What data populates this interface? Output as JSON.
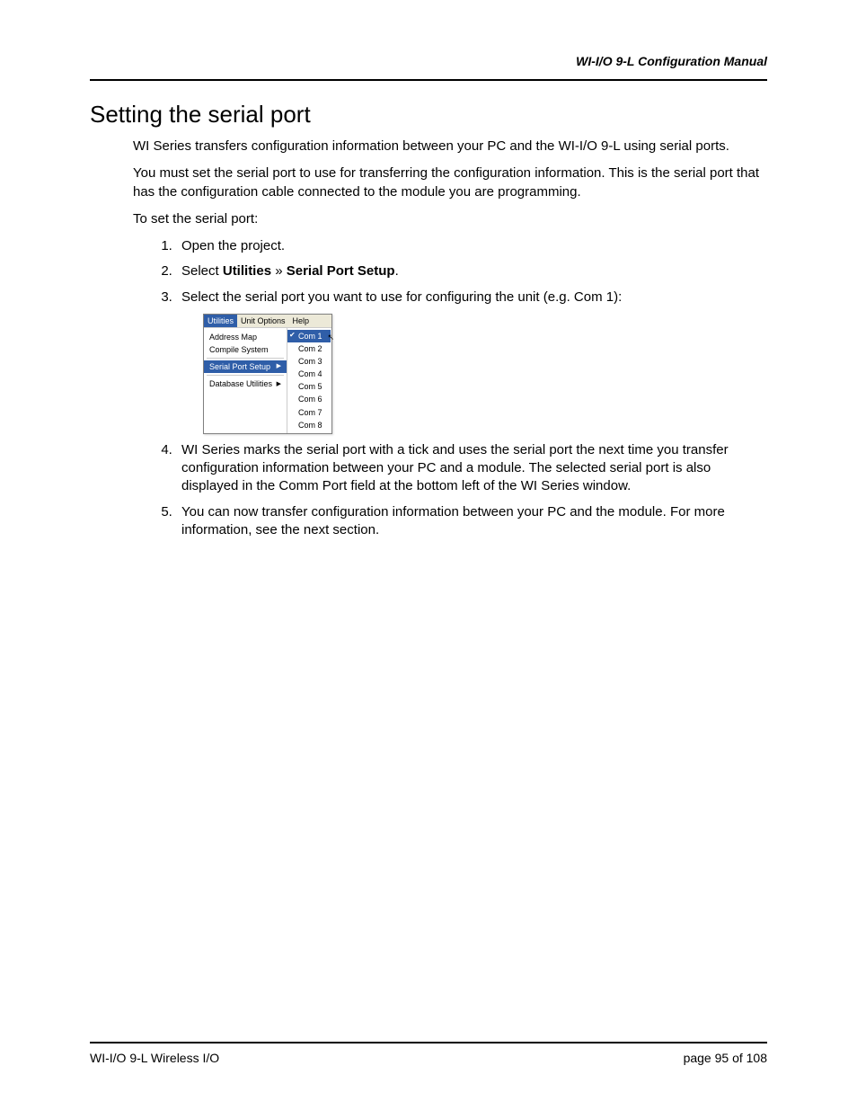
{
  "header": {
    "title": "WI-I/O 9-L Configuration Manual"
  },
  "section": {
    "title": "Setting the serial port"
  },
  "paragraphs": {
    "p1": "WI Series transfers configuration information between your PC and the WI-I/O 9-L using serial ports.",
    "p2": "You must set the serial port to use for transferring the configuration information. This is the serial port that has the configuration cable connected to the module you are programming.",
    "p3": "To set the serial port:"
  },
  "steps": {
    "s1": "Open the project.",
    "s2_pre": "Select ",
    "s2_b1": "Utilities",
    "s2_mid": " » ",
    "s2_b2": "Serial Port Setup",
    "s2_post": ".",
    "s3": "Select the serial port you want to use for configuring the unit (e.g. Com 1):",
    "s4": "WI Series marks the serial port with a tick and uses the serial port the next time you transfer configuration information between your PC and a module. The selected serial port is also displayed in the Comm Port field at the bottom left of the WI Series window.",
    "s5": "You can now transfer configuration information between your PC and the module. For more information, see the next section."
  },
  "menu": {
    "bar": {
      "utilities": "Utilities",
      "unitoptions": "Unit Options",
      "help": "Help"
    },
    "left": {
      "addressmap": "Address Map",
      "compile": "Compile System",
      "serialport": "Serial Port Setup",
      "database": "Database Utilities"
    },
    "right": {
      "c1": "Com 1",
      "c2": "Com 2",
      "c3": "Com 3",
      "c4": "Com 4",
      "c5": "Com 5",
      "c6": "Com 6",
      "c7": "Com 7",
      "c8": "Com 8"
    }
  },
  "footer": {
    "left": "WI-I/O 9-L Wireless I/O",
    "right": "page  95 of 108"
  }
}
